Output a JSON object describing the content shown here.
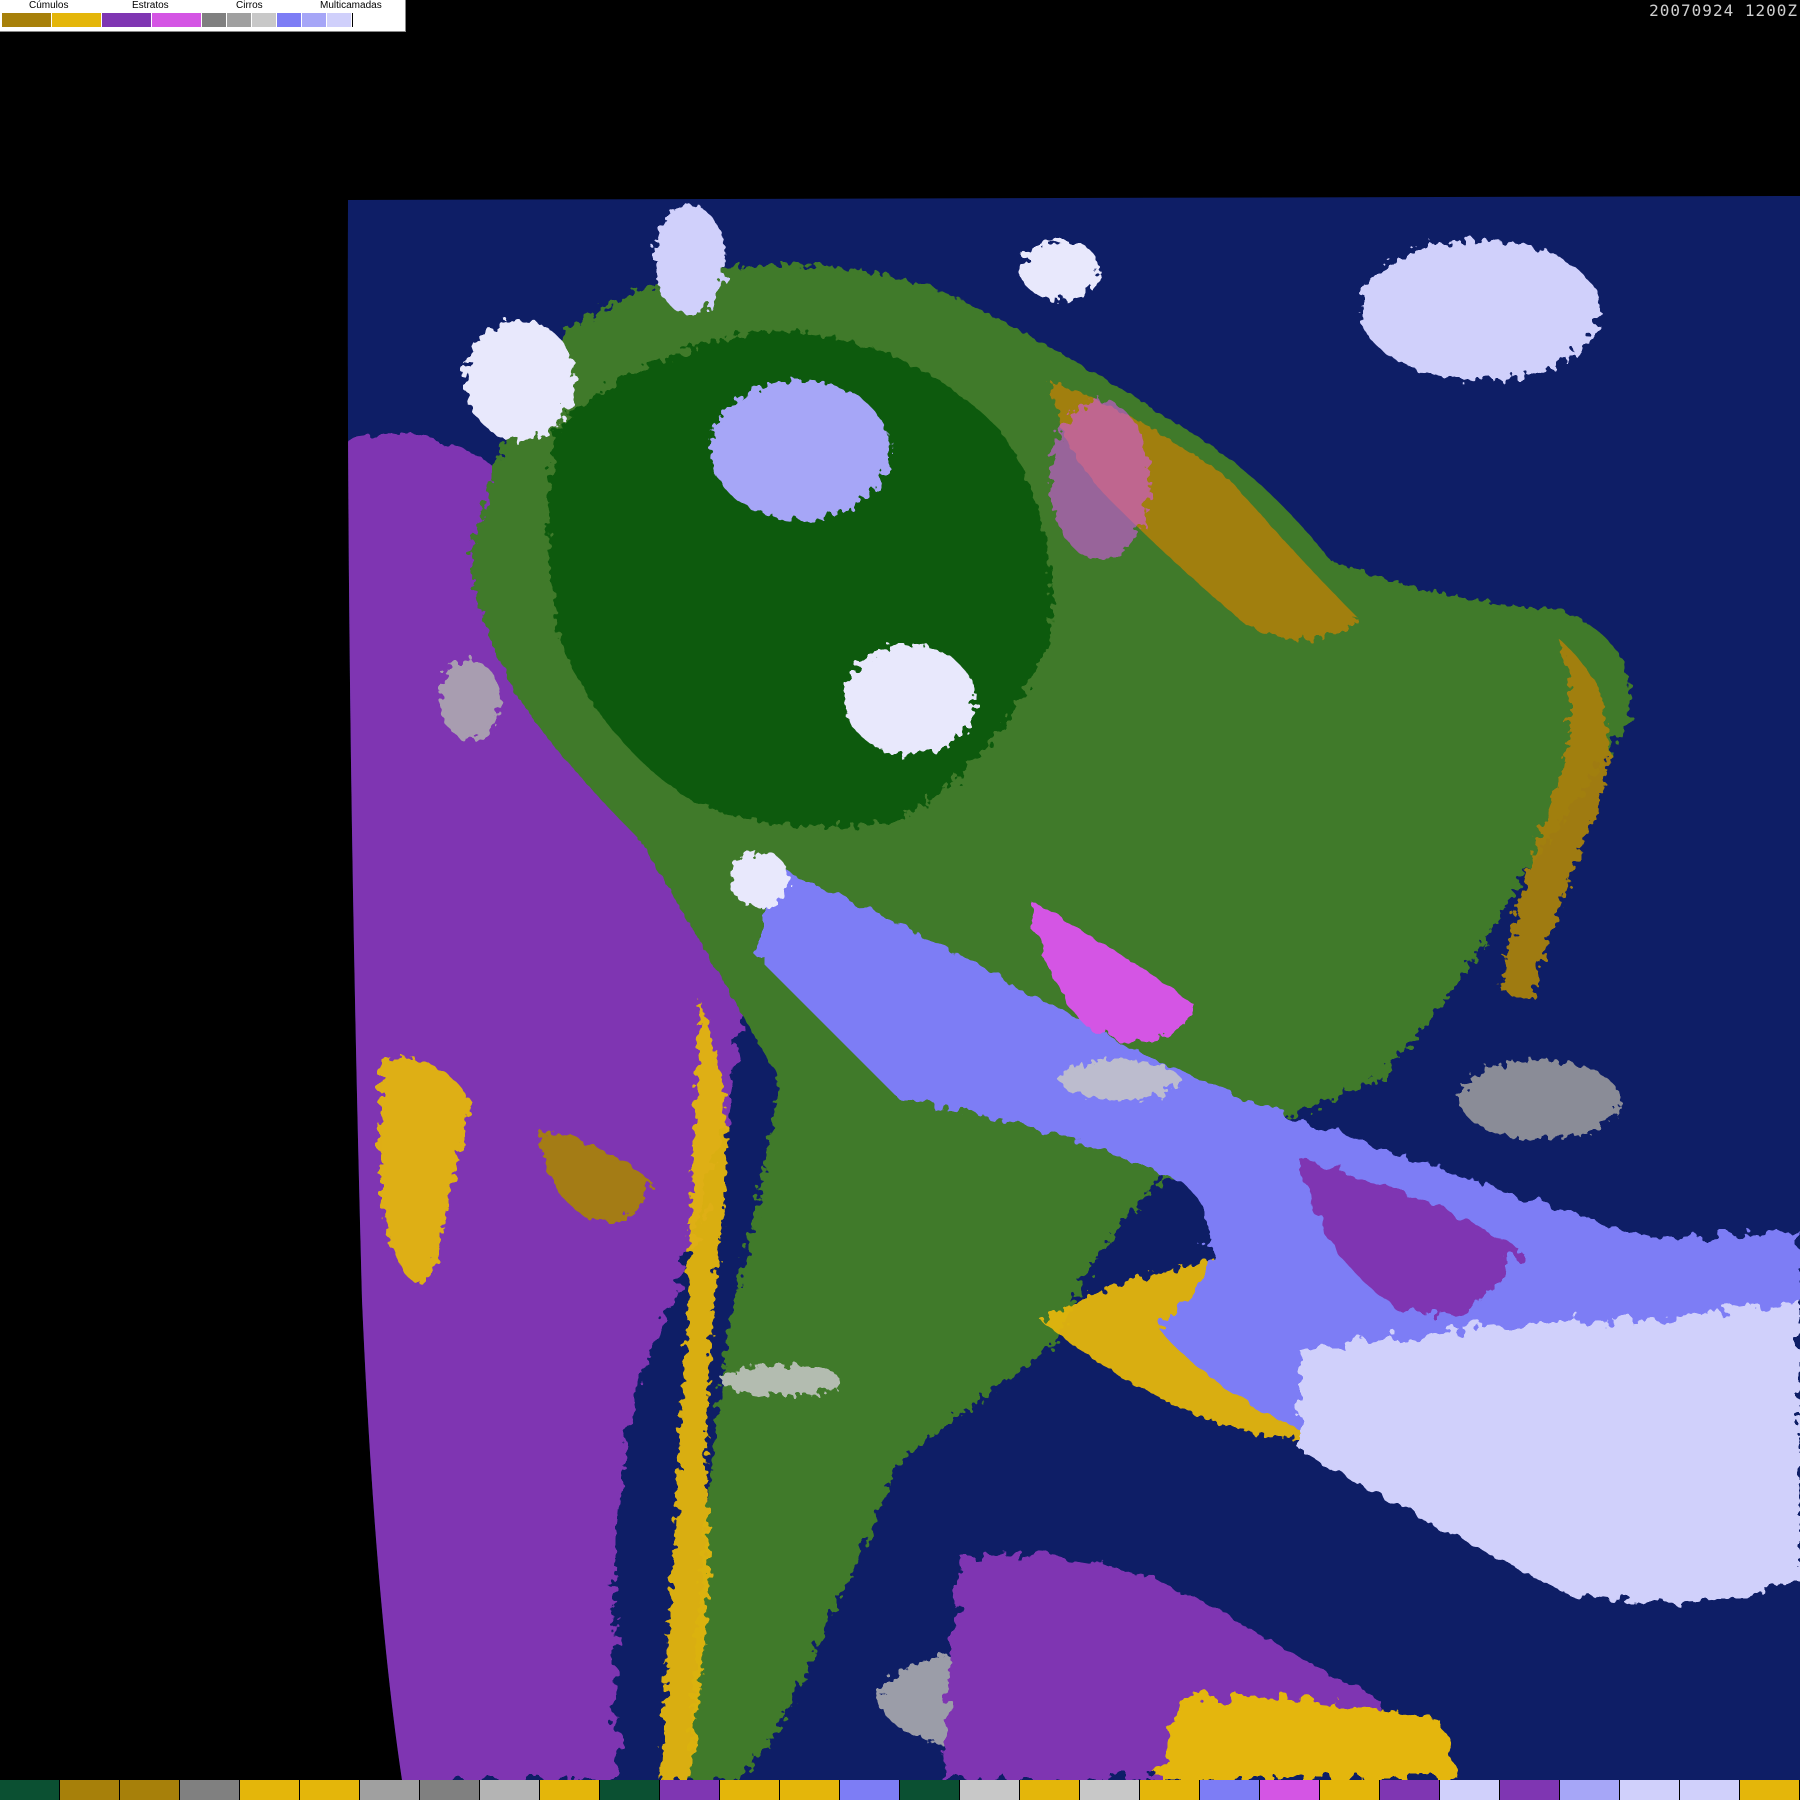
{
  "timestamp": "20070924 1200Z",
  "legend": {
    "groups": [
      {
        "label": "Cúmulos",
        "colors": [
          "#a7800a",
          "#e4b60a"
        ]
      },
      {
        "label": "Estratos",
        "colors": [
          "#7f36b2",
          "#d455e4"
        ]
      },
      {
        "label": "Cirros",
        "colors": [
          "#808080",
          "#a0a0a0",
          "#c8c8c8"
        ]
      },
      {
        "label": "Multicamadas",
        "colors": [
          "#7d7df5",
          "#a6a6f7",
          "#d0d0fb"
        ]
      }
    ]
  },
  "colors": {
    "ocean": "#0e1e66",
    "land_forest": "#0b5a0b",
    "land_green": "#3f7a2a",
    "stratus_low": "#7f36b2",
    "stratus_high": "#d455e4",
    "cumulus_low": "#a7800a",
    "cumulus_high": "#e4b60a",
    "cirrus": "#b0b0b0",
    "multilayer_low": "#7d7df5",
    "multilayer_high": "#d0d0fb"
  },
  "bottom_strip": [
    "#0b5032",
    "#a7800a",
    "#a7800a",
    "#808080",
    "#e4b60a",
    "#e4b60a",
    "#a0a0a0",
    "#808080",
    "#b4b4b4",
    "#e4b60a",
    "#0b5032",
    "#7f36b2",
    "#e4b60a",
    "#e4b60a",
    "#7d7df5",
    "#0b5032",
    "#c8c8c8",
    "#e4b60a",
    "#c8c8c8",
    "#e4b60a",
    "#7d7df5",
    "#d455e4",
    "#e4b60a",
    "#7f36b2",
    "#d0d0fb",
    "#7f36b2",
    "#a6a6f7",
    "#d0d0fb",
    "#d0d0fb",
    "#e4b60a"
  ]
}
